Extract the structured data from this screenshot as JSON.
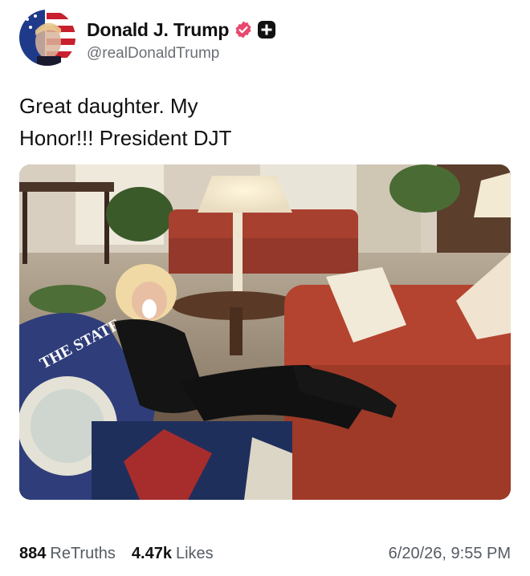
{
  "author": {
    "display_name": "Donald J. Trump",
    "handle": "@realDonaldTrump",
    "avatar_icon": "flag-portrait-avatar",
    "verified_icon": "verified-badge-icon",
    "verified_color": "#e8476f",
    "extra_badge_icon": "plus-badge-icon"
  },
  "post": {
    "text": "Great daughter. My\nHonor!!! President DJT",
    "media_alt": "Photo"
  },
  "stats": {
    "retruths_count": "884",
    "retruths_label": "ReTruths",
    "likes_count": "4.47k",
    "likes_label": "Likes",
    "timestamp": "6/20/26, 9:55 PM"
  },
  "pillow_text": "THE STATE"
}
